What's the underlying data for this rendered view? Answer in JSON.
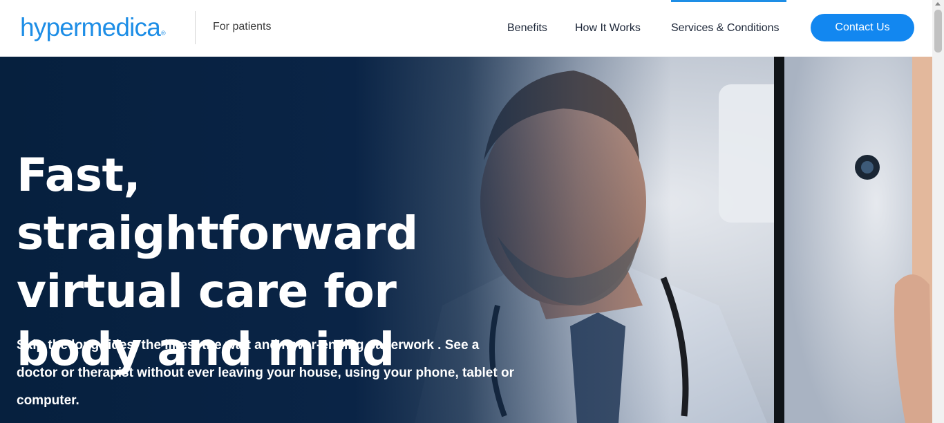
{
  "header": {
    "logo": {
      "text": "hypermedica",
      "registered": "®"
    },
    "audience": "For patients",
    "nav": [
      {
        "label": "Benefits"
      },
      {
        "label": "How It Works"
      },
      {
        "label": "Services & Conditions"
      }
    ],
    "cta": "Contact Us"
  },
  "hero": {
    "title": "Fast, straightforward virtual care for body and mind",
    "subtitle": "Skip the long rides, the lines, the wait and never-ending paperwork . See a doctor or therapist without ever leaving your house, using your phone, tablet or computer.",
    "image": "doctor-on-tablet-photo"
  },
  "colors": {
    "brand": "#1e8ee6",
    "button": "#1287f0",
    "hero_dark": "#0a2446",
    "nav_text": "#1a2436"
  }
}
